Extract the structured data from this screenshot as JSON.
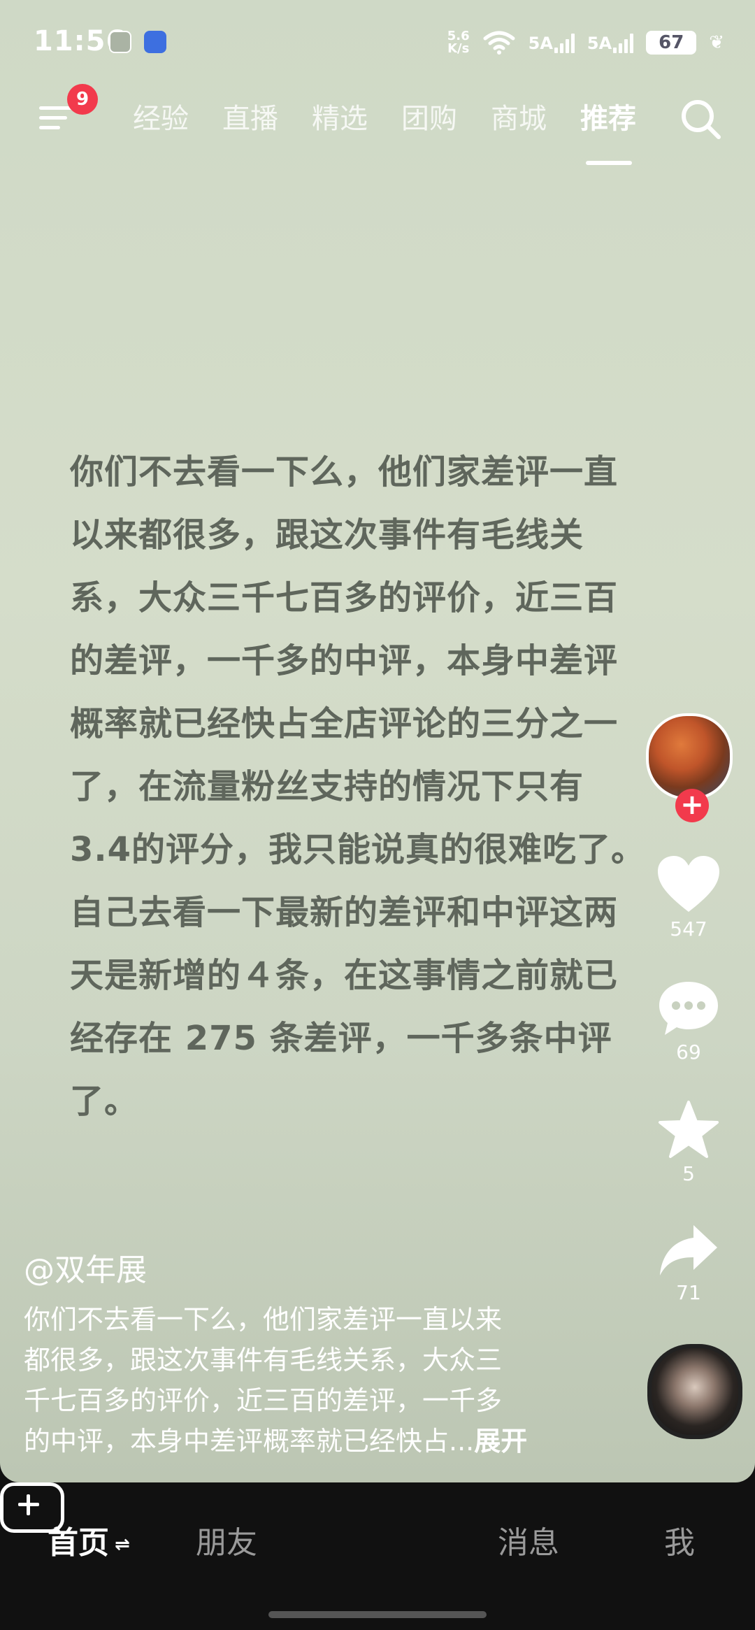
{
  "status_bar": {
    "time": "11:56",
    "net_speed_value": "5.6",
    "net_speed_unit": "K/s",
    "sim1": "5A",
    "sim2": "5A",
    "battery": "67"
  },
  "top_nav": {
    "badge_count": "9",
    "tabs": [
      {
        "label": "经验"
      },
      {
        "label": "直播"
      },
      {
        "label": "精选"
      },
      {
        "label": "团购"
      },
      {
        "label": "商城"
      },
      {
        "label": "推荐"
      }
    ],
    "active_tab": "推荐"
  },
  "main_text": {
    "lines": [
      "你们不去看一下么，他们家差评一直",
      "以来都很多，跟这次事件有毛线关",
      "系，大众三千七百多的评价，近三百",
      "的差评，一千多的中评，本身中差评",
      "概率就已经快占全店评论的三分之一",
      "了，在流量粉丝支持的情况下只有",
      " 3.4的评分，我只能说真的很难吃了。",
      "自己去看一下最新的差评和中评这两",
      "天是新增的４条，在这事情之前就已",
      "经存在 275 条差评，一千多条中评了。"
    ]
  },
  "actions": {
    "likes": "547",
    "comments": "69",
    "favorites": "5",
    "shares": "71"
  },
  "caption": {
    "author": "@双年展",
    "lines": [
      "你们不去看一下么，他们家差评一直以来",
      "都很多，跟这次事件有毛线关系，大众三",
      "千七百多的评价，近三百的差评，一千多",
      "的中评，本身中差评概率就已经快占..."
    ],
    "expand_label": "展开"
  },
  "bottom_nav": {
    "home": "首页",
    "home_swap": "⇌",
    "friends": "朋友",
    "messages": "消息",
    "me": "我"
  },
  "colors": {
    "background": "#cfd9c6",
    "main_text": "#5f665c",
    "accent_red": "#f23a4c",
    "nav_bg": "#111111"
  }
}
